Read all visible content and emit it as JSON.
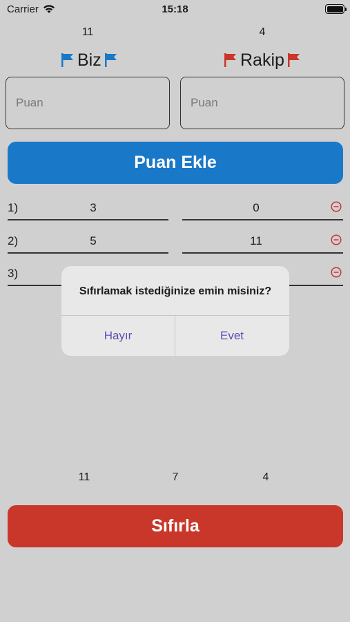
{
  "status_bar": {
    "carrier": "Carrier",
    "time": "15:18"
  },
  "header": {
    "us_total": "11",
    "them_total": "4",
    "us_label": "Biz",
    "them_label": "Rakip",
    "us_flag_color": "#1a78c8",
    "them_flag_color": "#c9372b"
  },
  "inputs": {
    "us_placeholder": "Puan",
    "them_placeholder": "Puan",
    "us_value": "",
    "them_value": ""
  },
  "add_button": {
    "label": "Puan Ekle",
    "color": "#1a78c8"
  },
  "rounds": [
    {
      "index": "1)",
      "us": "3",
      "them": "0"
    },
    {
      "index": "2)",
      "us": "5",
      "them": "11"
    },
    {
      "index": "3)",
      "us": "",
      "them": ""
    }
  ],
  "summary": {
    "us": "11",
    "middle": "7",
    "them": "4"
  },
  "reset_button": {
    "label": "Sıfırla",
    "color": "#c9372b"
  },
  "alert": {
    "message": "Sıfırlamak istediğinize emin misiniz?",
    "no_label": "Hayır",
    "yes_label": "Evet"
  }
}
